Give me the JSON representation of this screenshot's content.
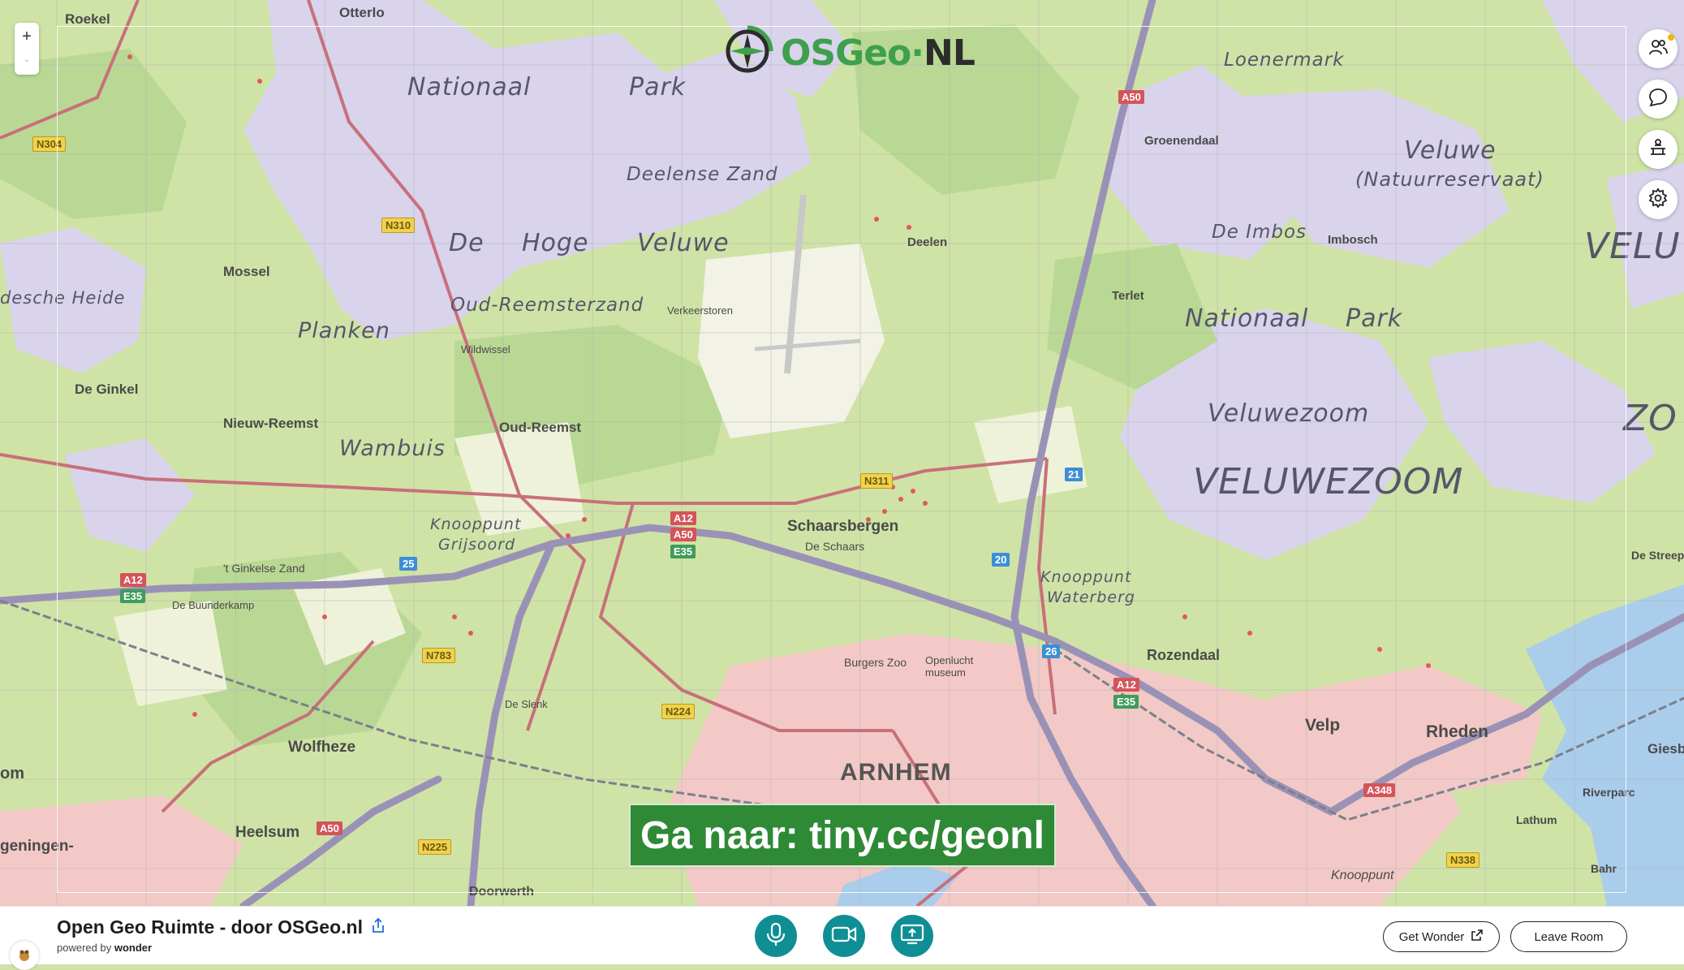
{
  "app": {
    "room_title": "Open Geo Ruimte - door OSGeo.nl",
    "powered_by_prefix": "powered by",
    "powered_by_brand": "wonder"
  },
  "logo": {
    "part1": "OSGeo",
    "sep": "·",
    "part2": "NL"
  },
  "zoom": {
    "in_label": "+",
    "out_label": "-"
  },
  "banner": {
    "text": "Ga naar: tiny.cc/geonl"
  },
  "buttons": {
    "get_wonder": "Get Wonder",
    "leave_room": "Leave Room"
  },
  "right_rail": [
    "people-icon",
    "chat-icon",
    "broadcast-icon",
    "settings-icon"
  ],
  "map": {
    "region_labels": {
      "nationaal": "Nationaal",
      "park": "Park",
      "deelense_zand": "Deelense Zand",
      "de": "De",
      "hoge": "Hoge",
      "veluwe": "Veluwe",
      "oud_reemsterzand": "Oud-Reemsterzand",
      "planken": "Planken",
      "wambuis": "Wambuis",
      "knooppunt_grijsoord_1": "Knooppunt",
      "knooppunt_grijsoord_2": "Grijsoord",
      "loenermark": "Loenermark",
      "veluwe_right": "Veluwe",
      "natuurreservaat": "(Natuurreservaat)",
      "de_imbos": "De Imbos",
      "velu": "VELU",
      "nationaal_right": "Nationaal",
      "park_right": "Park",
      "veluwezoom": "Veluwezoom",
      "veluwezoom_caps": "VELUWEZOOM",
      "zo": "ZO",
      "knooppunt_waterberg_1": "Knooppunt",
      "knooppunt_waterberg_2": "Waterberg",
      "desche_heide": "desche Heide"
    },
    "place_labels": {
      "otterlo": "Otterlo",
      "roekel": "Roekel",
      "mossel": "Mossel",
      "de_ginkel": "De Ginkel",
      "nieuw_reemst": "Nieuw-Reemst",
      "oud_reemst": "Oud-Reemst",
      "schaarsbergen": "Schaarsbergen",
      "deelen": "Deelen",
      "groenendaal": "Groenendaal",
      "terlet": "Terlet",
      "imbosch": "Imbosch",
      "rozendaal": "Rozendaal",
      "velp": "Velp",
      "rheden": "Rheden",
      "wolfheze": "Wolfheze",
      "heelsum": "Heelsum",
      "riverparc": "Riverparc",
      "lathum": "Lathum",
      "giesbeek": "Giesbe",
      "bahr": "Bahr",
      "de_streep": "De Streep",
      "de_slenk": "De Slenk",
      "burgers_zoo": "Burgers Zoo",
      "openlucht_museum": "Openlucht museum",
      "de_schaars": "De Schaars",
      "doorwerth": "Doorwerth",
      "oosterbeek_left": "om",
      "wageningen": "geningen-",
      "ginkelse_zand": "'t Ginkelse Zand",
      "de_buunderkamp": "De Buunderkamp",
      "wildwissel": "Wildwissel",
      "verkeerstoren": "Verkeerstoren",
      "knooppunt_velperbroek": "Knooppunt"
    },
    "city_label": "ARNHEM",
    "road_shields": {
      "n304": "N304",
      "n310": "N310",
      "n311": "N311",
      "n783": "N783",
      "n224": "N224",
      "n225": "N225",
      "n338": "N338",
      "a50_top": "A50",
      "a12": "A12",
      "a50_mid": "A50",
      "a12_left": "A12",
      "a12_right": "A12",
      "a50_bottom": "A50",
      "a348": "A348",
      "e35_mid": "E35",
      "e35_left": "E35",
      "e35_right": "E35",
      "exit_25": "25",
      "exit_20": "20",
      "exit_21": "21",
      "exit_26": "26"
    }
  }
}
